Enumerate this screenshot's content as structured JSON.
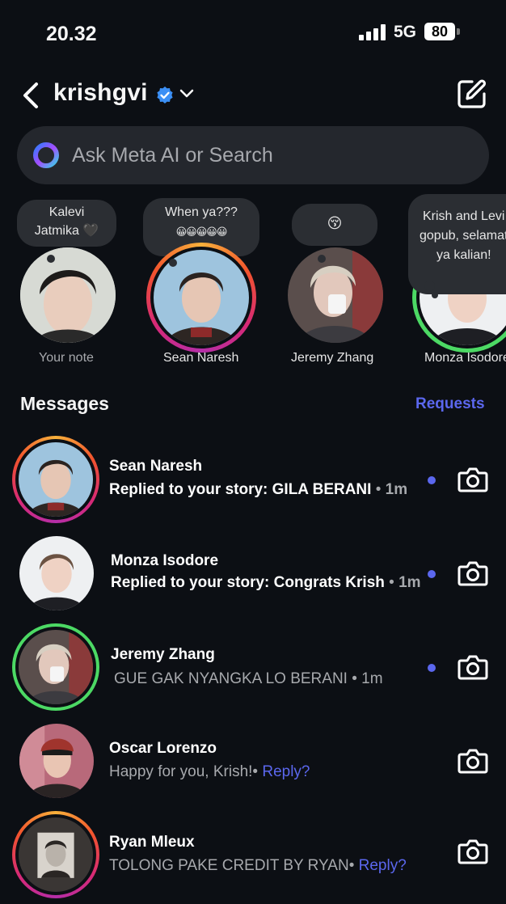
{
  "status_bar": {
    "time": "20.32",
    "network": "5G",
    "battery": "80"
  },
  "header": {
    "account": "krishgvi"
  },
  "search": {
    "placeholder": "Ask Meta AI or Search"
  },
  "notes": [
    {
      "bubble_line1": "Kalevi",
      "bubble_line2": "Jatmika 🖤",
      "name": "Your note"
    },
    {
      "bubble_line1": "When ya???",
      "bubble_line2": "😀😀😀😀😀",
      "name": "Sean Naresh"
    },
    {
      "bubble_line1": "😚",
      "bubble_line2": "",
      "name": "Jeremy Zhang"
    },
    {
      "bubble_line1": "Krish and Levi",
      "bubble_line2": "gopub, selamat",
      "bubble_line3": "ya kalian!",
      "name": "Monza Isodore"
    }
  ],
  "messages_title": "Messages",
  "requests_label": "Requests",
  "threads": [
    {
      "name": "Sean Naresh",
      "preview": "Replied to your story: GILA BERANI",
      "sep": " • ",
      "time": "1m",
      "unread": true
    },
    {
      "name": "Monza Isodore",
      "preview": "Replied to your story: Congrats Krish",
      "sep": " • ",
      "time": "1m",
      "unread": true
    },
    {
      "name": "Jeremy Zhang",
      "preview": "GUE GAK NYANGKA LO BERANI",
      "sep": " • ",
      "time": "1m",
      "unread": true
    },
    {
      "name": "Oscar Lorenzo",
      "preview": "Happy for you, Krish!",
      "sep": "• ",
      "reply": "Reply?",
      "unread": false
    },
    {
      "name": "Ryan Mleux",
      "preview": "TOLONG PAKE CREDIT BY RYAN",
      "sep": "• ",
      "reply": "Reply?",
      "unread": false
    }
  ],
  "colors": {
    "accent": "#5b67ee",
    "background": "#0c0f14",
    "story_ring_close_friends": "#4cd964"
  }
}
